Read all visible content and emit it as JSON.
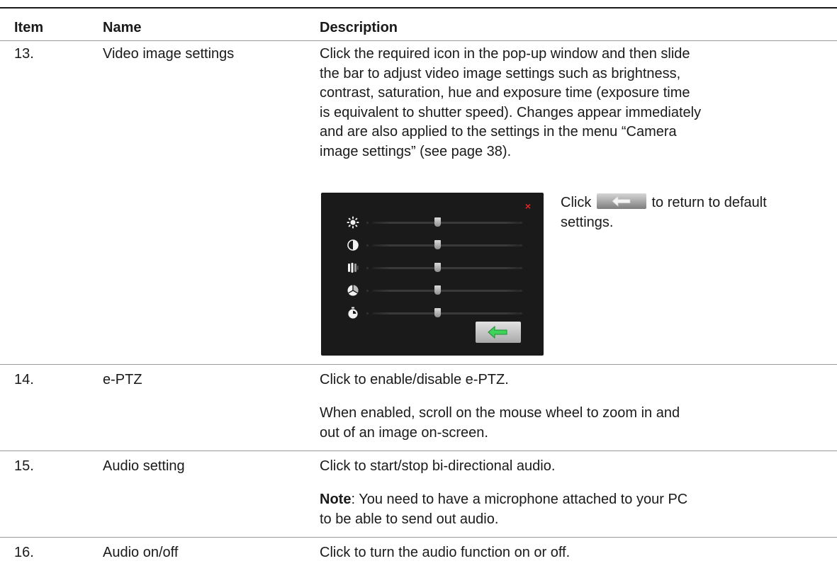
{
  "table": {
    "headers": {
      "item": "Item",
      "name": "Name",
      "description": "Description"
    },
    "rows": [
      {
        "item": "13.",
        "name": "Video image settings",
        "description_lines": [
          "Click the required icon in the pop-up window and then slide",
          "the bar to adjust video image settings such as brightness,",
          "contrast, saturation, hue and exposure time (exposure time",
          "is equivalent to shutter speed). Changes appear immediately",
          "and are also applied to the settings in the menu “Camera",
          "image settings” (see page 38)."
        ],
        "note_prefix": "Click",
        "note_suffix": "to return to default",
        "note_line2": "settings."
      },
      {
        "item": "14.",
        "name": "e-PTZ",
        "description": "Click to enable/disable e-PTZ.",
        "description2_lines": [
          "When enabled, scroll on the mouse wheel to zoom in and",
          "out of an image on-screen."
        ]
      },
      {
        "item": "15.",
        "name": "Audio setting",
        "description": "Click to start/stop bi-directional audio.",
        "note_label": "Note",
        "note_text_line1": ": You need to have a microphone attached to your PC",
        "note_text_line2": "to be able to send out audio."
      },
      {
        "item": "16.",
        "name": "Audio on/off",
        "description": "Click to turn the audio function on or off."
      }
    ]
  },
  "image_panel": {
    "close_glyph": "×",
    "sliders": [
      {
        "icon": "brightness-icon",
        "level": 0.5
      },
      {
        "icon": "contrast-icon",
        "level": 0.5
      },
      {
        "icon": "saturation-icon",
        "level": 0.5
      },
      {
        "icon": "hue-icon",
        "level": 0.5
      },
      {
        "icon": "exposure-time-icon",
        "level": 0.5
      }
    ],
    "default_button_icon": "return-arrow-icon",
    "accent_color": "#3fd35a",
    "close_color": "#e02424"
  }
}
